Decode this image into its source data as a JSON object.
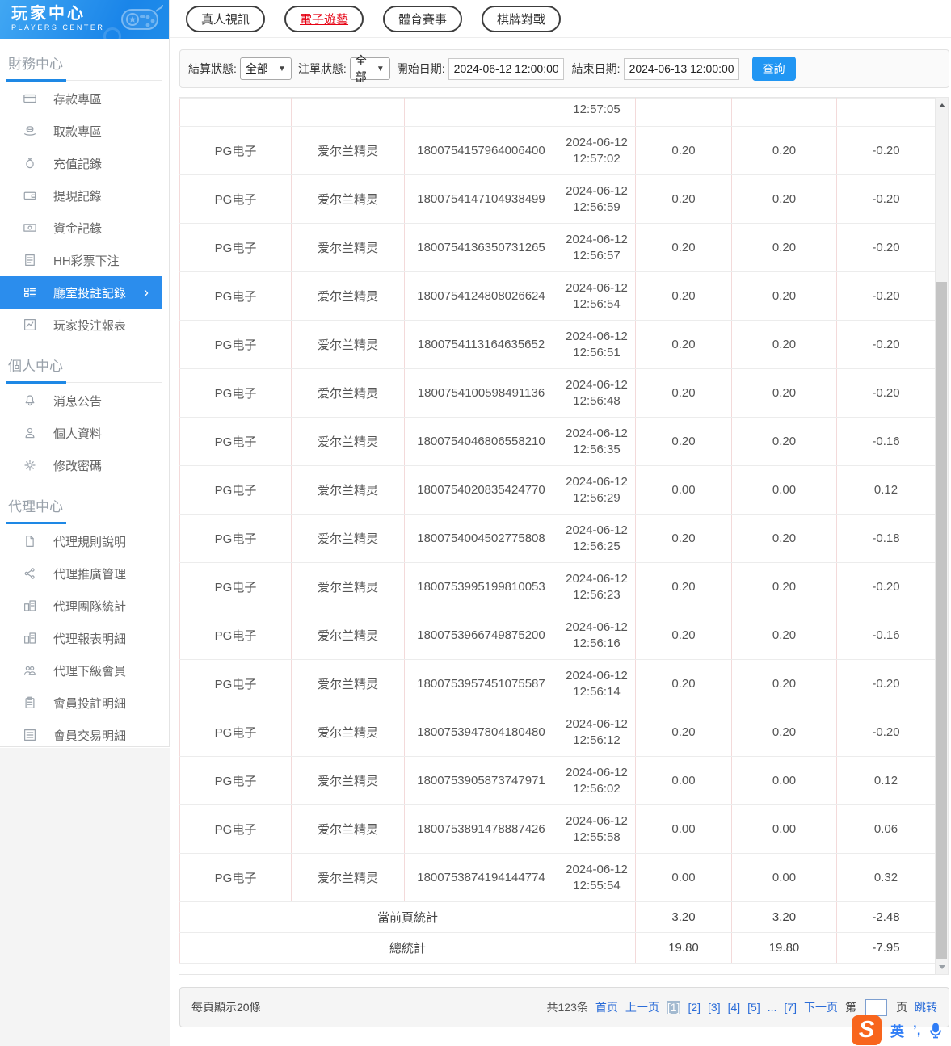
{
  "app": {
    "title": "玩家中心",
    "subtitle": "PLAYERS CENTER"
  },
  "sidebar": {
    "sections": [
      {
        "title": "財務中心",
        "items": [
          {
            "label": "存款專區",
            "icon": "card-icon"
          },
          {
            "label": "取款專區",
            "icon": "hand-coin-icon"
          },
          {
            "label": "充值記錄",
            "icon": "moneybag-icon"
          },
          {
            "label": "提現記錄",
            "icon": "wallet-icon"
          },
          {
            "label": "資金記錄",
            "icon": "banknote-icon"
          },
          {
            "label": "HH彩票下注",
            "icon": "document-icon"
          },
          {
            "label": "廳室投註記錄",
            "icon": "list-grid-icon",
            "active": true
          },
          {
            "label": "玩家投注報表",
            "icon": "chart-icon"
          }
        ]
      },
      {
        "title": "個人中心",
        "items": [
          {
            "label": "消息公告",
            "icon": "bell-icon"
          },
          {
            "label": "個人資料",
            "icon": "person-icon"
          },
          {
            "label": "修改密碼",
            "icon": "gear-icon"
          }
        ]
      },
      {
        "title": "代理中心",
        "items": [
          {
            "label": "代理規則說明",
            "icon": "file-icon"
          },
          {
            "label": "代理推廣管理",
            "icon": "share-icon"
          },
          {
            "label": "代理團隊統計",
            "icon": "stats-icon"
          },
          {
            "label": "代理報表明細",
            "icon": "stats-icon"
          },
          {
            "label": "代理下級會員",
            "icon": "people-icon"
          },
          {
            "label": "會員投註明細",
            "icon": "clipboard-icon"
          },
          {
            "label": "會員交易明細",
            "icon": "list-square-icon"
          }
        ]
      }
    ]
  },
  "tabs": [
    {
      "label": "真人視訊"
    },
    {
      "label": "電子遊藝",
      "active": true
    },
    {
      "label": "體育賽事"
    },
    {
      "label": "棋牌對戰"
    }
  ],
  "filters": {
    "settle_label": "結算狀態:",
    "settle_value": "全部",
    "order_label": "注單狀態:",
    "order_value": "全部",
    "start_label": "開始日期:",
    "start_value": "2024-06-12 12:00:00",
    "end_label": "結束日期:",
    "end_value": "2024-06-13 12:00:00",
    "search_label": "查詢"
  },
  "table": {
    "partial_row": {
      "time": "12:57:05"
    },
    "rows": [
      {
        "platform": "PG电子",
        "game": "爱尔兰精灵",
        "order_id": "1800754157964006400",
        "date": "2024-06-12",
        "time": "12:57:02",
        "bet": "0.20",
        "valid_bet": "0.20",
        "win_loss": "-0.20"
      },
      {
        "platform": "PG电子",
        "game": "爱尔兰精灵",
        "order_id": "1800754147104938499",
        "date": "2024-06-12",
        "time": "12:56:59",
        "bet": "0.20",
        "valid_bet": "0.20",
        "win_loss": "-0.20"
      },
      {
        "platform": "PG电子",
        "game": "爱尔兰精灵",
        "order_id": "1800754136350731265",
        "date": "2024-06-12",
        "time": "12:56:57",
        "bet": "0.20",
        "valid_bet": "0.20",
        "win_loss": "-0.20"
      },
      {
        "platform": "PG电子",
        "game": "爱尔兰精灵",
        "order_id": "1800754124808026624",
        "date": "2024-06-12",
        "time": "12:56:54",
        "bet": "0.20",
        "valid_bet": "0.20",
        "win_loss": "-0.20"
      },
      {
        "platform": "PG电子",
        "game": "爱尔兰精灵",
        "order_id": "1800754113164635652",
        "date": "2024-06-12",
        "time": "12:56:51",
        "bet": "0.20",
        "valid_bet": "0.20",
        "win_loss": "-0.20"
      },
      {
        "platform": "PG电子",
        "game": "爱尔兰精灵",
        "order_id": "1800754100598491136",
        "date": "2024-06-12",
        "time": "12:56:48",
        "bet": "0.20",
        "valid_bet": "0.20",
        "win_loss": "-0.20"
      },
      {
        "platform": "PG电子",
        "game": "爱尔兰精灵",
        "order_id": "1800754046806558210",
        "date": "2024-06-12",
        "time": "12:56:35",
        "bet": "0.20",
        "valid_bet": "0.20",
        "win_loss": "-0.16"
      },
      {
        "platform": "PG电子",
        "game": "爱尔兰精灵",
        "order_id": "1800754020835424770",
        "date": "2024-06-12",
        "time": "12:56:29",
        "bet": "0.00",
        "valid_bet": "0.00",
        "win_loss": "0.12"
      },
      {
        "platform": "PG电子",
        "game": "爱尔兰精灵",
        "order_id": "1800754004502775808",
        "date": "2024-06-12",
        "time": "12:56:25",
        "bet": "0.20",
        "valid_bet": "0.20",
        "win_loss": "-0.18"
      },
      {
        "platform": "PG电子",
        "game": "爱尔兰精灵",
        "order_id": "1800753995199810053",
        "date": "2024-06-12",
        "time": "12:56:23",
        "bet": "0.20",
        "valid_bet": "0.20",
        "win_loss": "-0.20"
      },
      {
        "platform": "PG电子",
        "game": "爱尔兰精灵",
        "order_id": "1800753966749875200",
        "date": "2024-06-12",
        "time": "12:56:16",
        "bet": "0.20",
        "valid_bet": "0.20",
        "win_loss": "-0.16"
      },
      {
        "platform": "PG电子",
        "game": "爱尔兰精灵",
        "order_id": "1800753957451075587",
        "date": "2024-06-12",
        "time": "12:56:14",
        "bet": "0.20",
        "valid_bet": "0.20",
        "win_loss": "-0.20"
      },
      {
        "platform": "PG电子",
        "game": "爱尔兰精灵",
        "order_id": "1800753947804180480",
        "date": "2024-06-12",
        "time": "12:56:12",
        "bet": "0.20",
        "valid_bet": "0.20",
        "win_loss": "-0.20"
      },
      {
        "platform": "PG电子",
        "game": "爱尔兰精灵",
        "order_id": "1800753905873747971",
        "date": "2024-06-12",
        "time": "12:56:02",
        "bet": "0.00",
        "valid_bet": "0.00",
        "win_loss": "0.12"
      },
      {
        "platform": "PG电子",
        "game": "爱尔兰精灵",
        "order_id": "1800753891478887426",
        "date": "2024-06-12",
        "time": "12:55:58",
        "bet": "0.00",
        "valid_bet": "0.00",
        "win_loss": "0.06"
      },
      {
        "platform": "PG电子",
        "game": "爱尔兰精灵",
        "order_id": "1800753874194144774",
        "date": "2024-06-12",
        "time": "12:55:54",
        "bet": "0.00",
        "valid_bet": "0.00",
        "win_loss": "0.32"
      }
    ],
    "summaries": [
      {
        "label": "當前頁統計",
        "bet": "3.20",
        "valid_bet": "3.20",
        "win_loss": "-2.48"
      },
      {
        "label": "總統計",
        "bet": "19.80",
        "valid_bet": "19.80",
        "win_loss": "-7.95"
      }
    ]
  },
  "pagination": {
    "per_page_text": "每頁顯示20條",
    "total_text": "共123条",
    "items": [
      {
        "text": "首页",
        "type": "link"
      },
      {
        "text": "上一页",
        "type": "link"
      },
      {
        "text": "[1]",
        "type": "current"
      },
      {
        "text": "[2]",
        "type": "link"
      },
      {
        "text": "[3]",
        "type": "link"
      },
      {
        "text": "[4]",
        "type": "link"
      },
      {
        "text": "[5]",
        "type": "link"
      },
      {
        "text": "...",
        "type": "link"
      },
      {
        "text": "[7]",
        "type": "link"
      },
      {
        "text": "下一页",
        "type": "link"
      }
    ],
    "jump_prefix": "第",
    "jump_suffix": "页",
    "jump_button": "跳转",
    "jump_value": ""
  },
  "ime": {
    "logo": "S",
    "lang": "英",
    "punct": "’,"
  },
  "colors": {
    "accent_blue": "#2b8ded",
    "header_gradient_start": "#41a7f3",
    "header_gradient_end": "#1a85e9",
    "tab_active_red": "#e60012",
    "link_blue": "#2a6cd8",
    "search_button_blue": "#2196f3",
    "table_vline_pink": "#f3dada",
    "table_hline_gray": "#ececec",
    "current_page_bg": "#a3bad0",
    "ime_orange": "#f8651d"
  }
}
